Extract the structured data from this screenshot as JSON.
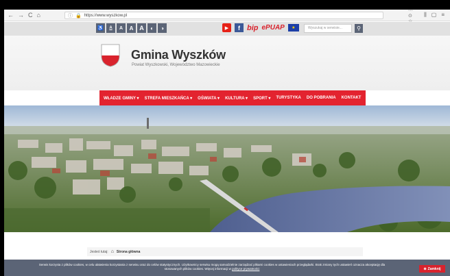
{
  "browser": {
    "nav": [
      "←",
      "→",
      "C",
      "⌂"
    ],
    "url": "https://www.wyszkow.pl",
    "addr_tools": "··· ⊙ ☆",
    "right_tools": [
      "⫼",
      "▢",
      "≡"
    ]
  },
  "accessibility": {
    "buttons": [
      "A",
      "A",
      "A",
      "A",
      "◐",
      "◑",
      "♿"
    ]
  },
  "social": {
    "bip": "bip",
    "epuap": "ePUAP",
    "search_placeholder": "Wyszukaj w serwisie..."
  },
  "header": {
    "title": "Gmina Wyszków",
    "subtitle": "Powiat Wyszkowski, Województwo Mazowieckie"
  },
  "menu": [
    "WŁADZE GMINY ▾",
    "STREFA MIESZKAŃCA ▾",
    "OŚWIATA ▾",
    "KULTURA ▾",
    "SPORT ▾",
    "TURYSTYKA",
    "DO POBRANIA",
    "KONTAKT"
  ],
  "breadcrumb": {
    "prefix": "Jesteś tutaj:",
    "current": "Strona główna"
  },
  "cookie": {
    "text": "Serwis korzysta z plików cookies, w celu ułatwienia korzystania z serwisu oraz do celów statystycznych. Użytkownicy serwisu mogą samodzielnie zarządzać plikami cookies w ustawieniach przeglądarki. Brak zmiany tych ustawień oznacza akceptację dla",
    "text2": "stosowanych plików cookies. Więcej informacji w",
    "link": "polityce prywatności",
    "close": "Zamknij"
  },
  "colors": {
    "accent": "#e3232f",
    "toolbar": "#5b6476"
  }
}
